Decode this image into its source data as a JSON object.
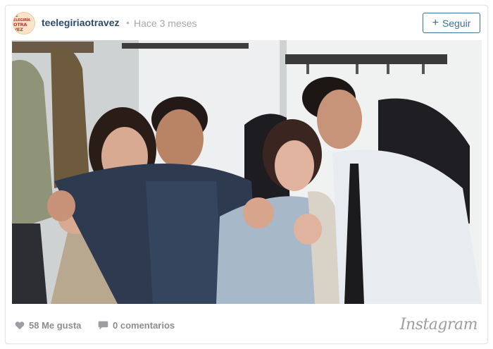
{
  "post": {
    "avatar_text_top": "TE ELEGIRÍA",
    "avatar_text_bottom": "OTRA VEZ",
    "username": "teelegiriaotravez",
    "separator": "•",
    "time": "Hace 3 meses",
    "follow_label": "Seguir",
    "follow_plus": "+"
  },
  "stats": {
    "likes": "58 Me gusta",
    "comments": "0 comentarios"
  },
  "brand": "Instagram",
  "colors": {
    "username": "#2e4a6b",
    "follow": "#3f729b",
    "muted": "#a5a7aa"
  },
  "icons": {
    "like": "heart-icon",
    "comment": "comment-bubble-icon",
    "follow": "plus-icon"
  }
}
